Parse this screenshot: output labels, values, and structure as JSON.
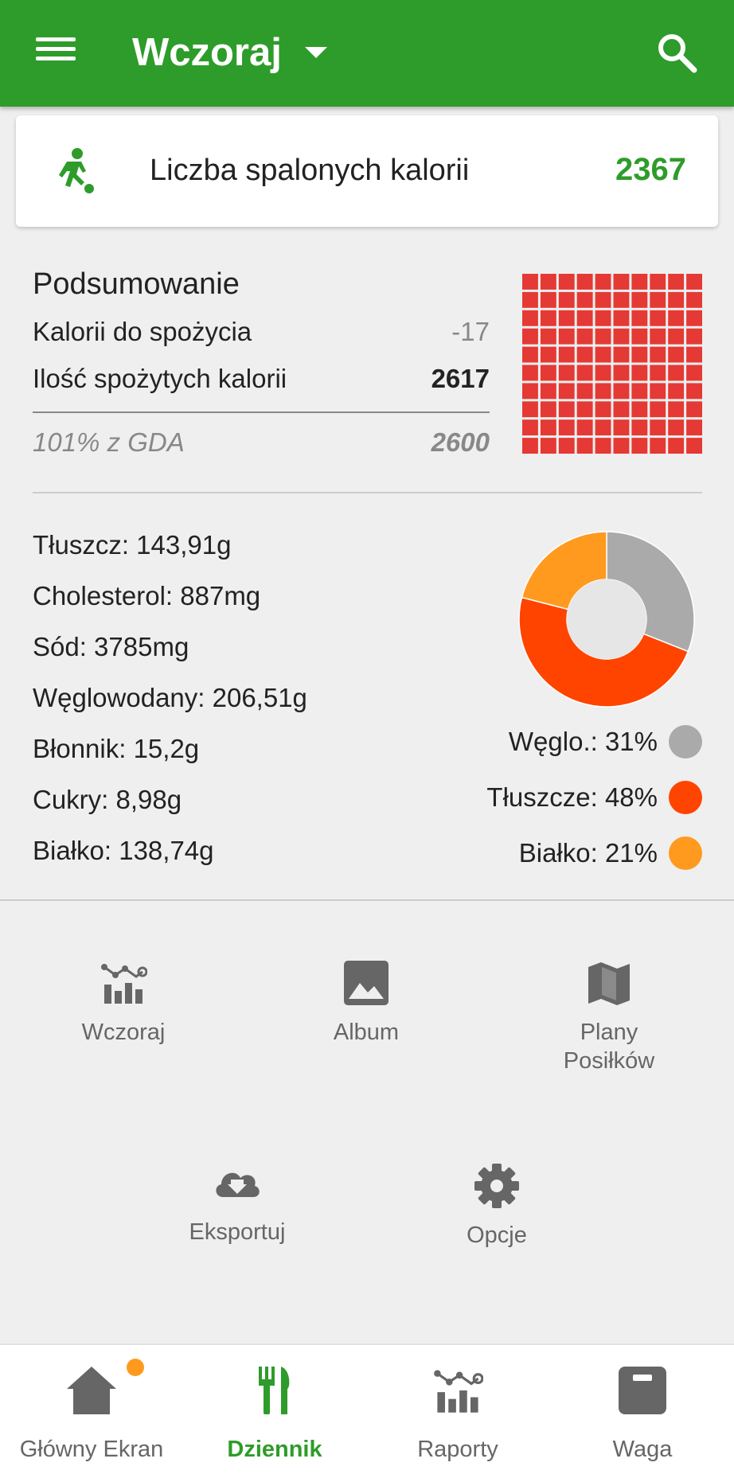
{
  "appbar": {
    "title": "Wczoraj",
    "color": "#2e9c2a"
  },
  "burned": {
    "label": "Liczba spalonych kalorii",
    "value": "2367",
    "icon": "runner-icon"
  },
  "summary": {
    "title": "Podsumowanie",
    "rows": [
      {
        "label": "Kalorii do spożycia",
        "value": "-17"
      },
      {
        "label": "Ilość spożytych kalorii",
        "value": "2617"
      },
      {
        "label": "101% z GDA",
        "value": "2600"
      }
    ],
    "grid_chart": {
      "filled_cells": 100,
      "total_cells": 100,
      "color": "#e53935"
    }
  },
  "nutrients": [
    "Tłuszcz: 143,91g",
    "Cholesterol: 887mg",
    "Sód: 3785mg",
    "Węglowodany: 206,51g",
    "Błonnik: 15,2g",
    "Cukry: 8,98g",
    "Białko: 138,74g"
  ],
  "macros": {
    "legend": [
      {
        "label": "Węglo.: 31%",
        "color": "#aaaaaa"
      },
      {
        "label": "Tłuszcze: 48%",
        "color": "#ff4400"
      },
      {
        "label": "Białko: 21%",
        "color": "#ff9a1f"
      }
    ]
  },
  "chart_data": {
    "type": "pie",
    "categories": [
      "Węglo.",
      "Tłuszcze",
      "Białko"
    ],
    "values": [
      31,
      48,
      21
    ],
    "colors": [
      "#aaaaaa",
      "#ff4400",
      "#ff9a1f"
    ]
  },
  "actions": [
    {
      "label": "Wczoraj",
      "icon": "chart-icon"
    },
    {
      "label": "Album",
      "icon": "image-icon"
    },
    {
      "label": "Plany\nPosiłków",
      "icon": "map-icon"
    },
    {
      "label": "Eksportuj",
      "icon": "cloud-download-icon"
    },
    {
      "label": "Opcje",
      "icon": "gear-icon"
    }
  ],
  "bottom_nav": [
    {
      "label": "Główny Ekran",
      "icon": "home-icon",
      "badge": true
    },
    {
      "label": "Dziennik",
      "icon": "fork-knife-icon",
      "active": true
    },
    {
      "label": "Raporty",
      "icon": "chart-icon"
    },
    {
      "label": "Waga",
      "icon": "scale-icon"
    }
  ]
}
